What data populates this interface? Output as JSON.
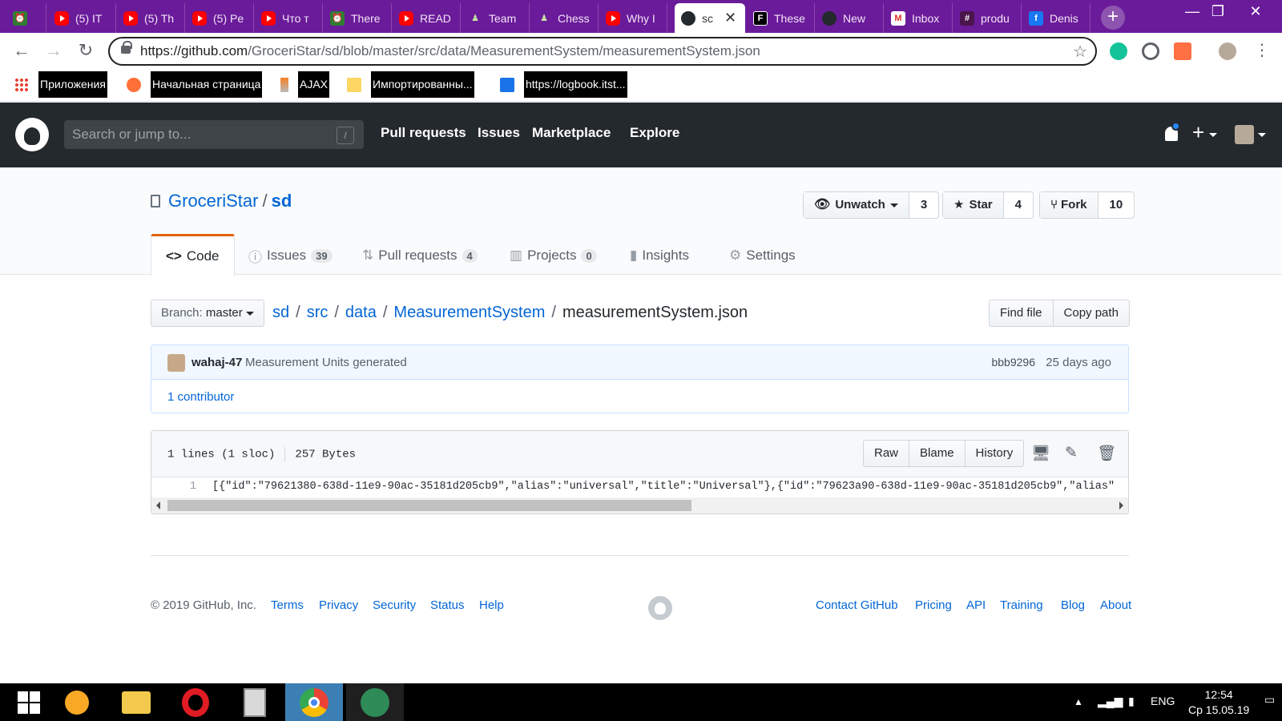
{
  "browser": {
    "tabs": [
      {
        "label": "",
        "icon": "alarm-icon",
        "icon_color": "#2e7d32"
      },
      {
        "label": "(5) IT",
        "icon": "youtube-icon"
      },
      {
        "label": "(5) Th",
        "icon": "youtube-icon"
      },
      {
        "label": "(5) Pe",
        "icon": "youtube-icon"
      },
      {
        "label": "Что т",
        "icon": "youtube-icon"
      },
      {
        "label": "There",
        "icon": "alarm-icon",
        "icon_color": "#2e7d32"
      },
      {
        "label": "READ",
        "icon": "youtube-icon"
      },
      {
        "label": "Team",
        "icon": "chess-icon"
      },
      {
        "label": "Chess",
        "icon": "chess-icon"
      },
      {
        "label": "Why I",
        "icon": "youtube-icon"
      },
      {
        "label": "sc",
        "icon": "github-icon",
        "active": true
      },
      {
        "label": "These",
        "icon": "f-letter-icon"
      },
      {
        "label": "New",
        "icon": "github-icon"
      },
      {
        "label": "Inbox",
        "icon": "gmail-icon"
      },
      {
        "label": "produ",
        "icon": "slack-icon"
      },
      {
        "label": "Denis",
        "icon": "facebook-icon"
      }
    ],
    "url_host": "https://github.com",
    "url_path": "/GroceriStar/sd/blob/master/src/data/MeasurementSystem/measurementSystem.json",
    "bookmarks": [
      {
        "label": "Приложения",
        "icon": "apps-grid-icon"
      },
      {
        "label": "Начальная страница",
        "icon": "firefox-icon"
      },
      {
        "label": "AJAX",
        "icon": "stackoverflow-icon"
      },
      {
        "label": "Импортированны...",
        "icon": "folder-icon"
      },
      {
        "label": "https://logbook.itst...",
        "icon": "book-icon"
      }
    ]
  },
  "github": {
    "search_placeholder": "Search or jump to...",
    "search_key": "/",
    "nav": [
      "Pull requests",
      "Issues",
      "Marketplace",
      "Explore"
    ],
    "repo_owner": "GroceriStar",
    "repo_name": "sd",
    "unwatch_label": "Unwatch",
    "watch_count": "3",
    "star_label": "Star",
    "star_count": "4",
    "fork_label": "Fork",
    "fork_count": "10",
    "tabs": [
      {
        "label": "Code",
        "count": ""
      },
      {
        "label": "Issues",
        "count": "39"
      },
      {
        "label": "Pull requests",
        "count": "4"
      },
      {
        "label": "Projects",
        "count": "0"
      },
      {
        "label": "Insights",
        "count": ""
      },
      {
        "label": "Settings",
        "count": ""
      }
    ],
    "branch_prefix": "Branch:",
    "branch": "master",
    "path": [
      "sd",
      "src",
      "data",
      "MeasurementSystem"
    ],
    "filename": "measurementSystem.json",
    "find_file": "Find file",
    "copy_path": "Copy path",
    "commit_author": "wahaj-47",
    "commit_message": "Measurement Units generated",
    "commit_sha": "bbb9296",
    "commit_date": "25 days ago",
    "contributors": "1 contributor",
    "file_lines": "1 lines (1 sloc)",
    "file_size": "257 Bytes",
    "raw": "Raw",
    "blame": "Blame",
    "history": "History",
    "line_number": "1",
    "code": "[{\"id\":\"79621380-638d-11e9-90ac-35181d205cb9\",\"alias\":\"universal\",\"title\":\"Universal\"},{\"id\":\"79623a90-638d-11e9-90ac-35181d205cb9\",\"alias\"",
    "footer": {
      "copyright": "© 2019 GitHub, Inc.",
      "left_links": [
        "Terms",
        "Privacy",
        "Security",
        "Status",
        "Help"
      ],
      "right_links": [
        "Contact GitHub",
        "Pricing",
        "API",
        "Training",
        "Blog",
        "About"
      ]
    }
  },
  "taskbar": {
    "apps": [
      "windows-start-icon",
      "aimp-icon",
      "file-explorer-icon",
      "opera-icon",
      "calculator-icon",
      "chrome-icon",
      "atom-icon"
    ],
    "lang": "ENG",
    "time": "12:54",
    "date": "Ср 15.05.19"
  }
}
